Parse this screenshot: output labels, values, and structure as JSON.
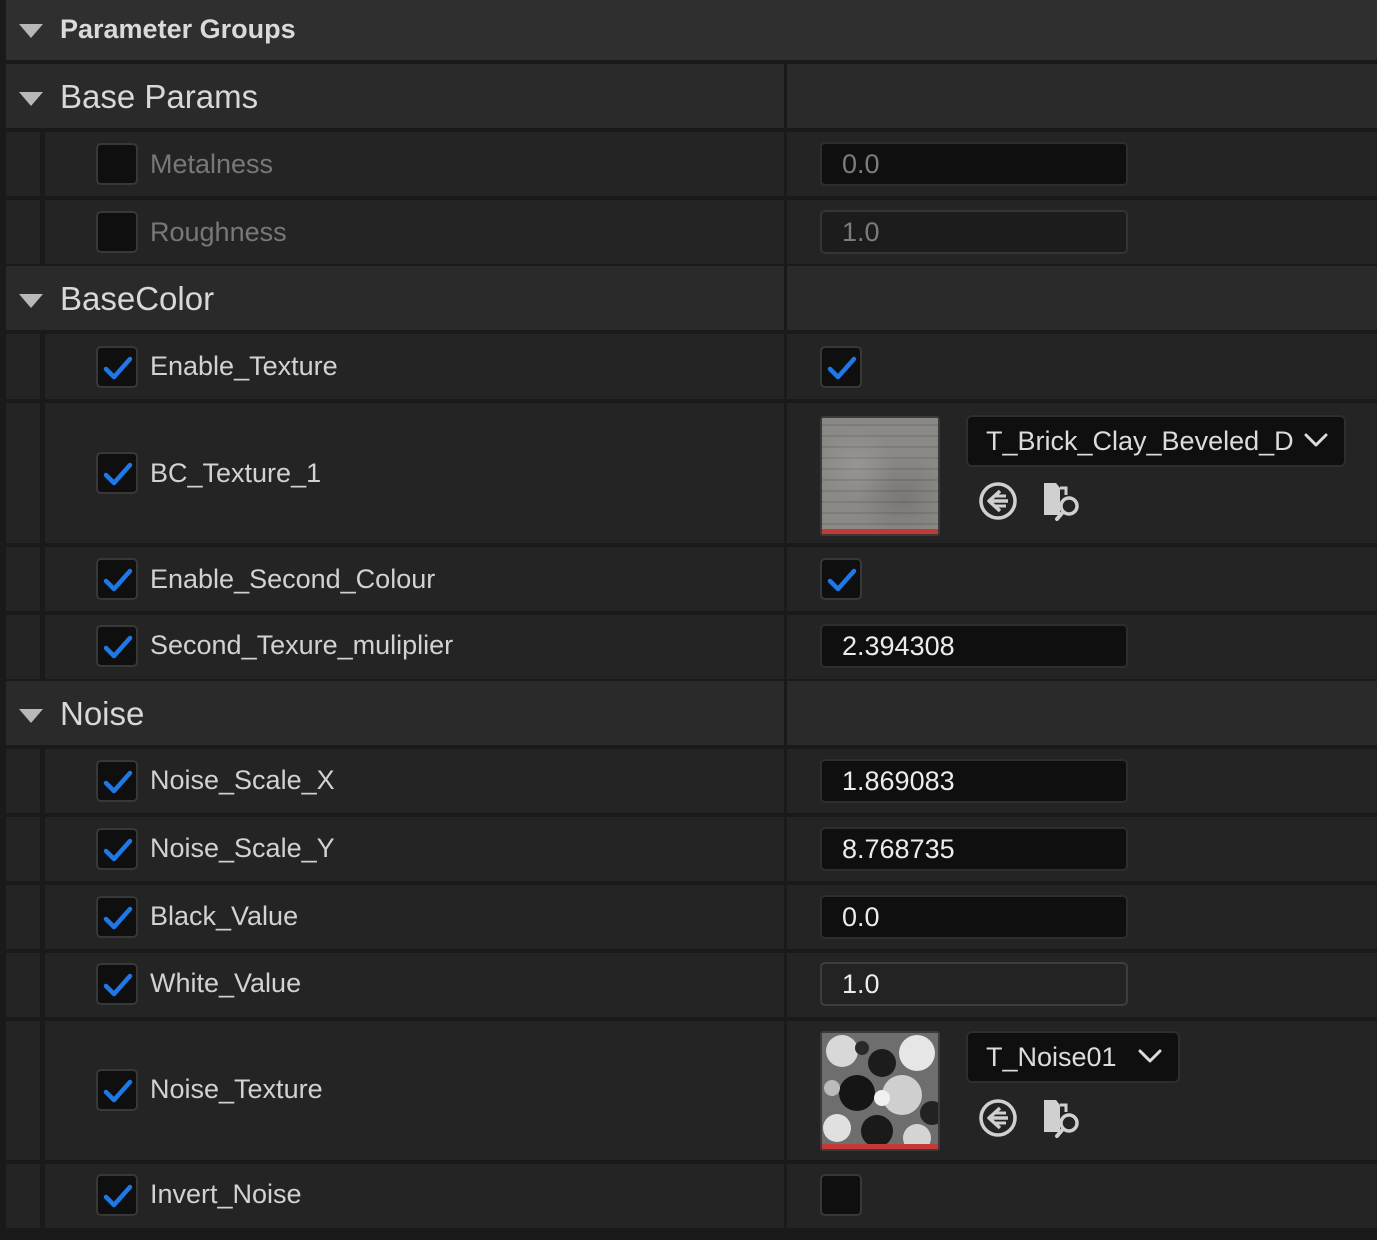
{
  "header": {
    "title": "Parameter Groups"
  },
  "groups": {
    "base_params": "Base Params",
    "base_color": "BaseColor",
    "noise": "Noise"
  },
  "params": {
    "metalness": {
      "label": "Metalness",
      "value": "0.0",
      "enabled": false
    },
    "roughness": {
      "label": "Roughness",
      "value": "1.0",
      "enabled": false
    },
    "enable_texture": {
      "label": "Enable_Texture",
      "value": true,
      "enabled": true
    },
    "bc_texture_1": {
      "label": "BC_Texture_1",
      "asset": "T_Brick_Clay_Beveled_D",
      "enabled": true
    },
    "enable_second_colour": {
      "label": "Enable_Second_Colour",
      "value": true,
      "enabled": true
    },
    "second_texture_multiplier": {
      "label": "Second_Texure_muliplier",
      "value": "2.394308",
      "enabled": true
    },
    "noise_scale_x": {
      "label": "Noise_Scale_X",
      "value": "1.869083",
      "enabled": true
    },
    "noise_scale_y": {
      "label": "Noise_Scale_Y",
      "value": "8.768735",
      "enabled": true
    },
    "black_value": {
      "label": "Black_Value",
      "value": "0.0",
      "enabled": true
    },
    "white_value": {
      "label": "White_Value",
      "value": "1.0",
      "enabled": true
    },
    "noise_texture": {
      "label": "Noise_Texture",
      "asset": "T_Noise01",
      "enabled": true
    },
    "invert_noise": {
      "label": "Invert_Noise",
      "value": false,
      "enabled": true
    }
  },
  "icons": {
    "expand": "triangle-down-icon",
    "check": "checkmark-icon",
    "use_selected": "use-selected-asset-icon",
    "browse": "browse-asset-icon",
    "dropdown": "chevron-down-icon"
  },
  "colors": {
    "accent_check": "#1e78e6",
    "texture_bar": "#c43838"
  }
}
